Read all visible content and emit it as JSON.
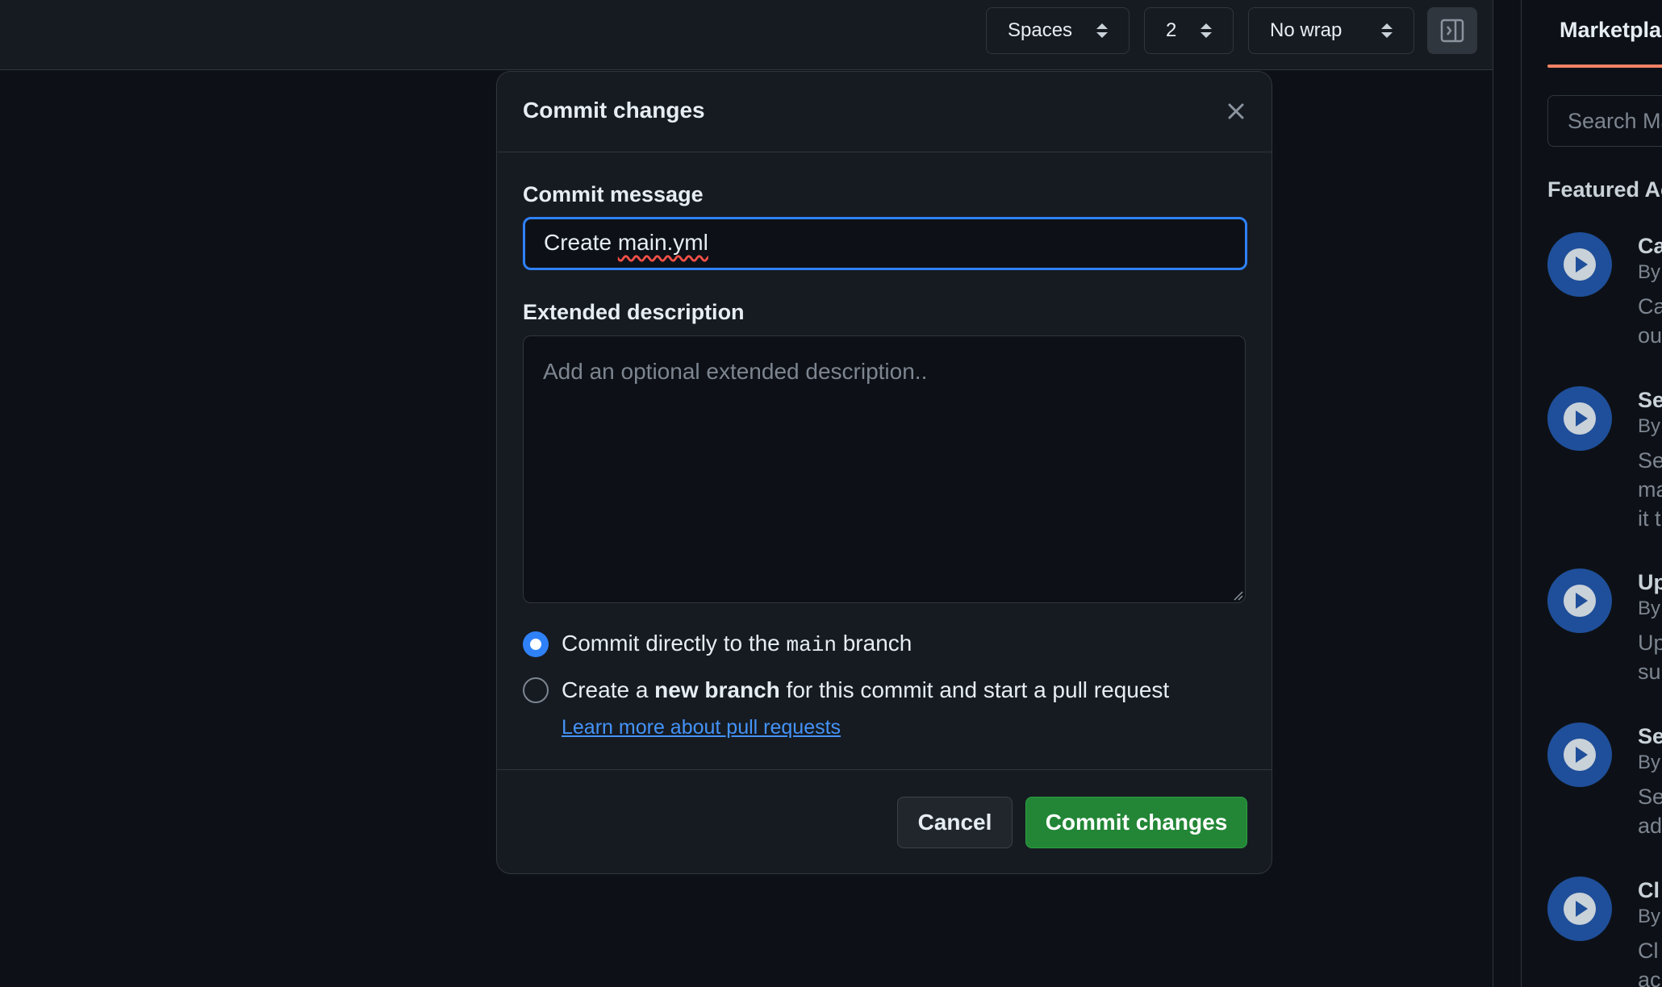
{
  "toolbar": {
    "indent_mode": "Spaces",
    "indent_size": "2",
    "wrap_mode": "No wrap",
    "panel_toggle_icon": "sidebar-toggle-icon"
  },
  "sidebar": {
    "tab_label": "Marketplace",
    "search_placeholder": "Search Marketplace",
    "featured_label": "Featured Actions",
    "items": [
      {
        "title": "Ca",
        "by": "By",
        "desc": [
          "Ca",
          "ou"
        ]
      },
      {
        "title": "Se",
        "by": "By",
        "desc": [
          "Se",
          "ma",
          "it t"
        ]
      },
      {
        "title": "Up",
        "by": "By",
        "desc": [
          "Up",
          "su"
        ]
      },
      {
        "title": "Se",
        "by": "By",
        "desc": [
          "Se",
          "ad"
        ]
      },
      {
        "title": "Cl",
        "by": "By",
        "desc": [
          "Cl",
          "ac"
        ]
      }
    ]
  },
  "dialog": {
    "title": "Commit changes",
    "close_icon": "close-icon",
    "message_label": "Commit message",
    "message_prefix": "Create ",
    "message_file": "main.yml",
    "description_label": "Extended description",
    "description_placeholder": "Add an optional extended description..",
    "option_direct": {
      "before": "Commit directly to the ",
      "branch": "main",
      "after": " branch",
      "checked": true
    },
    "option_new": {
      "before": "Create a ",
      "bold": "new branch",
      "after": " for this commit and start a pull request",
      "checked": false
    },
    "learn_link": "Learn more about pull requests",
    "cancel_label": "Cancel",
    "commit_label": "Commit changes"
  },
  "colors": {
    "accent": "#2f81f7",
    "primary_button": "#238636",
    "background": "#0d1117",
    "surface": "#161b22"
  }
}
